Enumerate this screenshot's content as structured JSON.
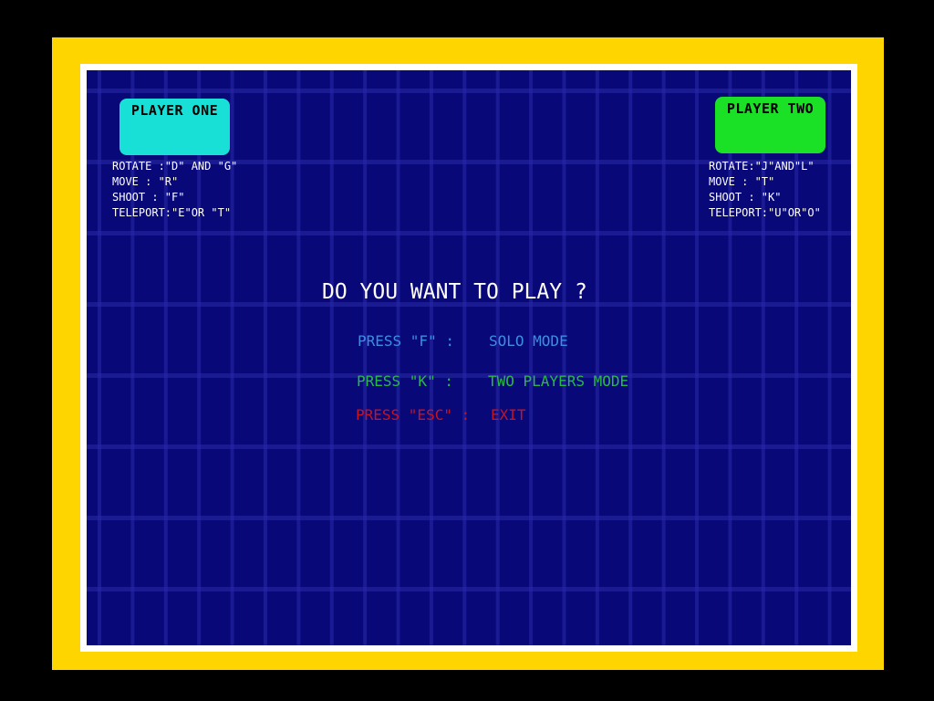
{
  "colors": {
    "background": "#000000",
    "frame_outer": "#FFD500",
    "frame_inner": "#FFFFFF",
    "play_area": "#080878",
    "grid_lines": "#2828AA",
    "player_one": "#19E0D6",
    "player_two": "#1AE026",
    "text_main": "#FFFFFF",
    "solo_mode": "#3A8FE0",
    "two_players_mode": "#2BB84A",
    "exit": "#C8141E"
  },
  "player_one": {
    "title": "PLAYER ONE",
    "controls": [
      "ROTATE :\"D\" AND \"G\"",
      "MOVE : \"R\"",
      "SHOOT : \"F\"",
      "TELEPORT:\"E\"OR \"T\""
    ]
  },
  "player_two": {
    "title": "PLAYER TWO",
    "controls": [
      "ROTATE:\"J\"AND\"L\"",
      "MOVE : \"T\"",
      "SHOOT : \"K\"",
      "TELEPORT:\"U\"OR\"O\""
    ]
  },
  "menu": {
    "prompt": "DO YOU WANT TO PLAY ?",
    "options": [
      {
        "key": "PRESS \"F\" :",
        "label": "SOLO MODE"
      },
      {
        "key": "PRESS \"K\" :",
        "label": "TWO PLAYERS MODE"
      },
      {
        "key": "PRESS \"ESC\" :",
        "label": "EXIT"
      }
    ]
  }
}
